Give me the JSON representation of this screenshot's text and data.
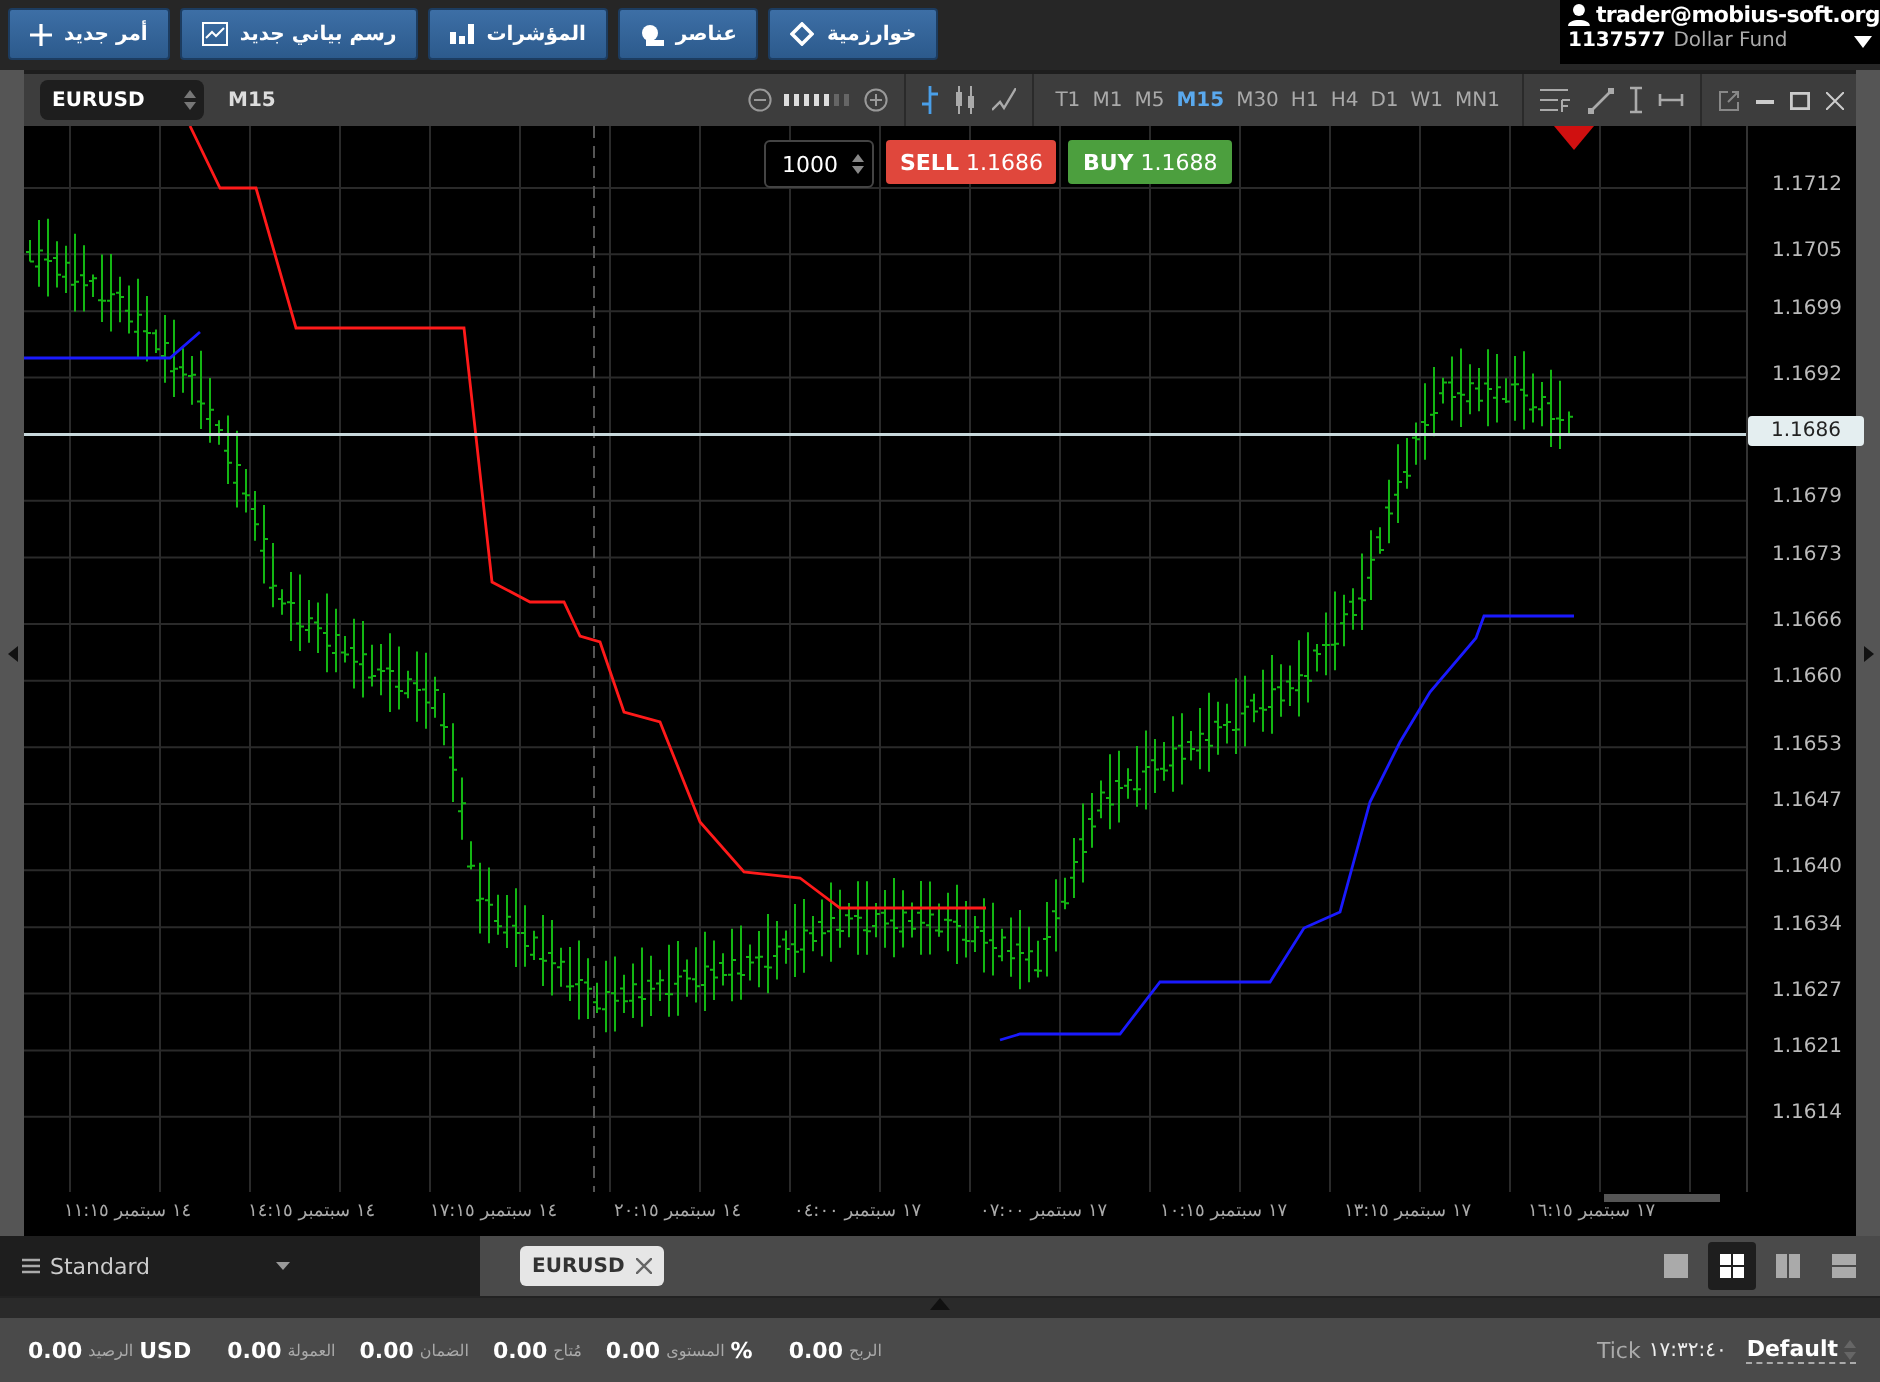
{
  "toolbar": {
    "buttons": [
      {
        "label": "خوارزمية",
        "kind": "diamond"
      },
      {
        "label": "عناصر",
        "kind": "shapes"
      },
      {
        "label": "المؤشرات",
        "kind": "bars"
      },
      {
        "label": "رسم بياني جديد",
        "kind": "chart"
      },
      {
        "label": "أمر جديد",
        "kind": "plus"
      }
    ]
  },
  "account": {
    "user": "trader@mobius-soft.org",
    "number": "1137577",
    "name": "Dollar Fund"
  },
  "chart_window": {
    "symbol": "EURUSD",
    "timeframe_label": "M15",
    "timeframes": [
      {
        "label": "MN1",
        "selected": false
      },
      {
        "label": "W1",
        "selected": false
      },
      {
        "label": "D1",
        "selected": false
      },
      {
        "label": "H4",
        "selected": false
      },
      {
        "label": "H1",
        "selected": false
      },
      {
        "label": "M30",
        "selected": false
      },
      {
        "label": "M15",
        "selected": true
      },
      {
        "label": "M5",
        "selected": false
      },
      {
        "label": "M1",
        "selected": false
      },
      {
        "label": "T1",
        "selected": false
      }
    ],
    "quantity": "1000",
    "sell": {
      "label": "SELL",
      "price": "1.1686"
    },
    "buy": {
      "label": "BUY",
      "price": "1.1688"
    },
    "price_ticks": [
      "1.1712",
      "1.1705",
      "1.1699",
      "1.1692",
      "1.1679",
      "1.1673",
      "1.1666",
      "1.1660",
      "1.1653",
      "1.1647",
      "1.1640",
      "1.1634",
      "1.1627",
      "1.1621",
      "1.1614"
    ],
    "current_price": "1.1686",
    "time_labels": [
      "١٧ سبتمبر ١٦:١٥",
      "١٧ سبتمبر ١٣:١٥",
      "١٧ سبتمبر ١٠:١٥",
      "١٧ سبتمبر ٠٧:٠٠",
      "١٧ سبتمبر ٠٤:٠٠",
      "١٤ سبتمبر ٢٠:١٥",
      "١٤ سبتمبر ١٧:١٥",
      "١٤ سبتمبر ١٤:١٥",
      "١٤ سبتمبر ١١:١٥"
    ]
  },
  "workspace": {
    "name": "Standard",
    "tabs": [
      {
        "label": "EURUSD",
        "selected": true
      }
    ],
    "layouts": [
      {
        "kind": "rows",
        "selected": false
      },
      {
        "kind": "columns",
        "selected": false
      },
      {
        "kind": "grid",
        "selected": true
      },
      {
        "kind": "single",
        "selected": false
      }
    ]
  },
  "status_bar": {
    "items": [
      {
        "label": "الربح",
        "value": "0.00"
      },
      {
        "unit": "%",
        "label": "المستوى",
        "value": "0.00"
      },
      {
        "label": "مُتاح",
        "value": "0.00"
      },
      {
        "label": "الضمان",
        "value": "0.00"
      },
      {
        "label": "العمولة",
        "value": "0.00"
      },
      {
        "unit": "USD",
        "label": "الرصيد",
        "value": "0.00"
      }
    ],
    "tick_label": "Tick",
    "tick_time": "١٧:٣٢:٤٠",
    "profile": "Default"
  }
}
